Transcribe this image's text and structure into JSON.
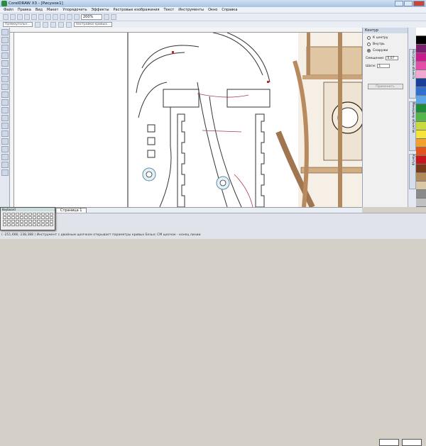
{
  "app": {
    "title": "CorelDRAW X3 - [Рисунок1]"
  },
  "menu": [
    "Файл",
    "Правка",
    "Вид",
    "Макет",
    "Упорядочить",
    "Эффекты",
    "Растровые изображения",
    "Текст",
    "Инструменты",
    "Окно",
    "Справка"
  ],
  "toolbar": {
    "zoom_value": "200%"
  },
  "propertybar": {
    "curve_type": "Прямоугольн...",
    "hint": "Настройки кривых..."
  },
  "docker": {
    "title": "Контур",
    "options": [
      {
        "label": "К центру",
        "selected": false
      },
      {
        "label": "Внутрь",
        "selected": false
      },
      {
        "label": "Снаружи",
        "selected": true
      }
    ],
    "offset_label": "Смещение:",
    "offset_value": "0,07",
    "steps_label": "Шаги:",
    "steps_value": "1",
    "apply_label": "Применить"
  },
  "docker_tabs": [
    "Настройки объекта",
    "Менеджер объектов",
    "Контур"
  ],
  "page_tab": "Страница 1",
  "status": {
    "coords": "( -251,666; 238,388 )",
    "message": "Инструмент с двойным щелчком открывает параметры кривых Безье; CM щелчок - конец линии"
  },
  "osk": {
    "title": "Keyboard"
  },
  "colors": {
    "palette": [
      "#ffffff",
      "#000000",
      "#7a1f6e",
      "#c81c8c",
      "#e54ca8",
      "#f0a7d0",
      "#1a3e9a",
      "#2f6fd0",
      "#5aa6e8",
      "#1d8b3a",
      "#55b54a",
      "#c9d93e",
      "#f5e33c",
      "#f2a02e",
      "#e2541e",
      "#c4161c",
      "#7a3b1a",
      "#b08a5a",
      "#d9c7a8",
      "#8a8a8a",
      "#c0c0c0"
    ]
  }
}
